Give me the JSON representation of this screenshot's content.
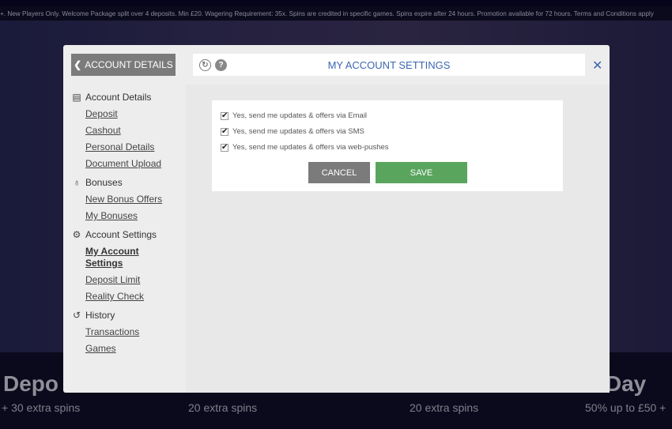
{
  "terms": "+. New Players Only. Welcome Package split over 4 deposits. Min £20. Wagering Requirement: 35x. Spins are credited in specific games. Spins expire after 24 hours. Promotion available for 72 hours. Terms and Conditions apply",
  "promos": [
    {
      "title": "Depo",
      "sub": "+ 30 extra spins"
    },
    {
      "title": "",
      "sub": "20 extra spins"
    },
    {
      "title": "",
      "sub": "20 extra spins"
    },
    {
      "title": "n Day",
      "sub": "50% up to £50 +"
    }
  ],
  "back_label": "ACCOUNT DETAILS",
  "header": {
    "title": "MY ACCOUNT SETTINGS",
    "help": "?"
  },
  "sidebar": [
    {
      "label": "Account Details",
      "icon": "id-card-icon",
      "items": [
        "Deposit",
        "Cashout",
        "Personal Details",
        "Document Upload"
      ]
    },
    {
      "label": "Bonuses",
      "icon": "money-bag-icon",
      "items": [
        "New Bonus Offers",
        "My Bonuses"
      ]
    },
    {
      "label": "Account Settings",
      "icon": "gear-icon",
      "items": [
        "My Account Settings",
        "Deposit Limit",
        "Reality Check"
      ]
    },
    {
      "label": "History",
      "icon": "history-icon",
      "items": [
        "Transactions",
        "Games"
      ]
    }
  ],
  "active_item": "My Account Settings",
  "options": [
    {
      "label": "Yes, send me updates & offers via Email",
      "checked": true
    },
    {
      "label": "Yes, send me updates & offers via SMS",
      "checked": true
    },
    {
      "label": "Yes, send me updates & offers via web-pushes",
      "checked": true
    }
  ],
  "cancel_label": "CANCEL",
  "save_label": "SAVE",
  "colors": {
    "save": "#5aa55e",
    "cancel": "#7b7b7b",
    "accent": "#3b66b0"
  }
}
